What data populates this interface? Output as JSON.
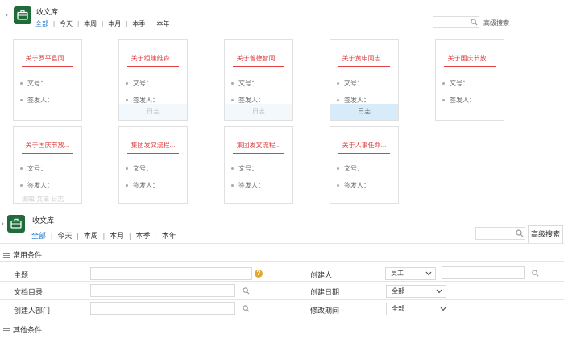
{
  "top": {
    "title": "收文库",
    "tabs": [
      "全部",
      "今天",
      "本周",
      "本月",
      "本季",
      "本年"
    ],
    "advanced_search": "高级搜索"
  },
  "cards": [
    {
      "title": "关于罗平县同...",
      "doc_no": "文号：",
      "signer": "签发人：",
      "tag": ""
    },
    {
      "title": "关于组建维森...",
      "doc_no": "文号：",
      "signer": "签发人：",
      "tag": "日志"
    },
    {
      "title": "关于曾德智同...",
      "doc_no": "文号：",
      "signer": "签发人：",
      "tag": "日志"
    },
    {
      "title": "关于黄申同志...",
      "doc_no": "文号：",
      "signer": "签发人：",
      "tag": "日志"
    },
    {
      "title": "关于国庆节放...",
      "doc_no": "文号：",
      "signer": "签发人：",
      "tag": ""
    },
    {
      "title": "关于国庆节放...",
      "doc_no": "文号：",
      "signer": "签发人：",
      "tag": "编辑 文单 日志"
    },
    {
      "title": "集团发文流程...",
      "doc_no": "文号：",
      "signer": "签发人：",
      "tag": ""
    },
    {
      "title": "集团发文流程...",
      "doc_no": "文号：",
      "signer": "签发人：",
      "tag": ""
    },
    {
      "title": "关于人事任命...",
      "doc_no": "文号：",
      "signer": "签发人：",
      "tag": ""
    }
  ],
  "bottom": {
    "title": "收文库",
    "tabs": [
      "全部",
      "今天",
      "本周",
      "本月",
      "本季",
      "本年"
    ],
    "advanced_search": "高级搜索",
    "common_conditions": "常用条件",
    "other_conditions": "其他条件",
    "fields": {
      "subject": "主题",
      "doc_dir": "文档目录",
      "creator_dept": "创建人部门",
      "creator": "创建人",
      "creator_type": "员工",
      "create_date": "创建日期",
      "create_date_value": "全部",
      "modify_period": "修改期间",
      "modify_period_value": "全部"
    }
  }
}
